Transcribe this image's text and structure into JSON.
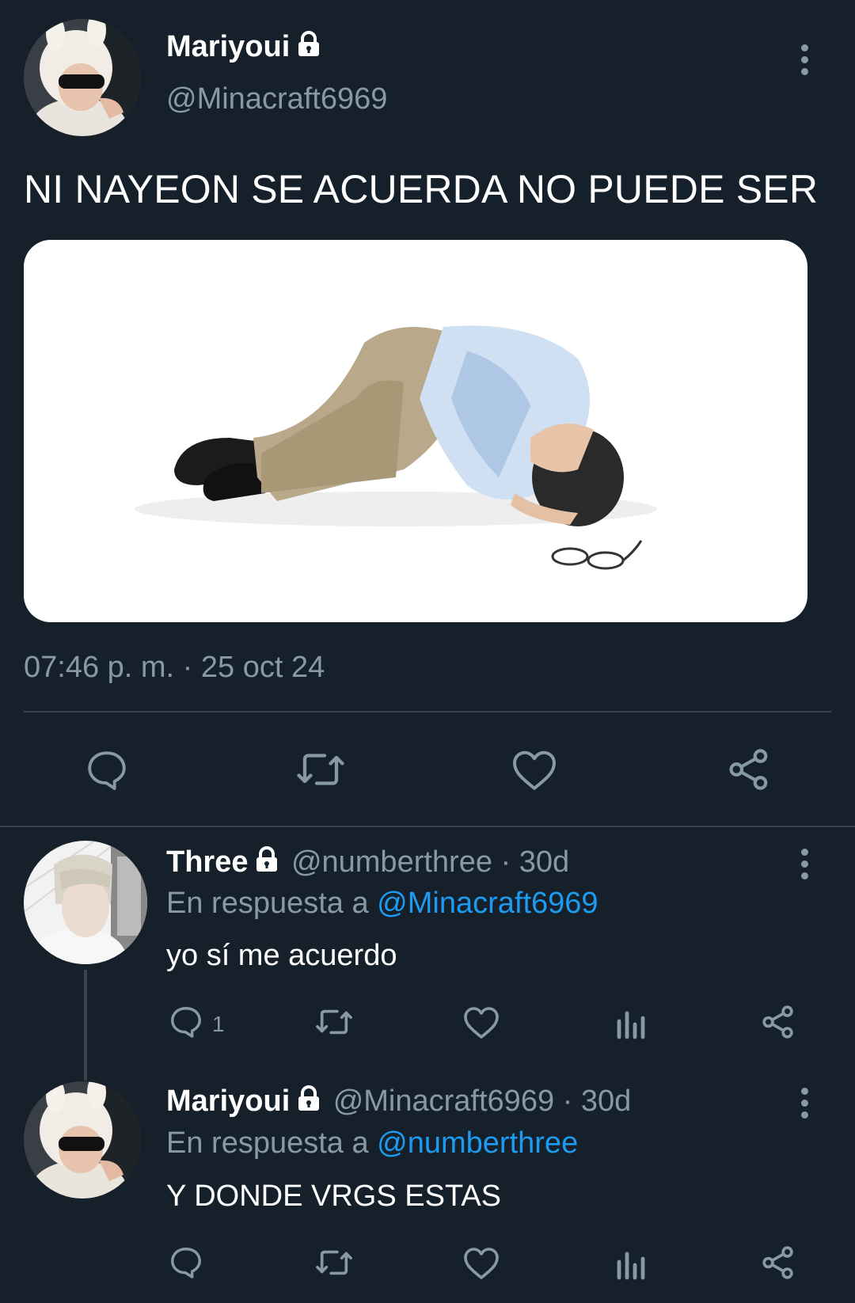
{
  "main_tweet": {
    "author_name": "Mariyoui",
    "author_handle": "@Minacraft6969",
    "text": "NI NAYEON SE ACUERDA NO PUEDE SER",
    "timestamp": "07:46 p. m. · 25 oct 24",
    "actions": [
      "reply-icon",
      "retweet-icon",
      "like-icon",
      "share-icon"
    ]
  },
  "replies": [
    {
      "author_name": "Three",
      "author_handle_time": "@numberthree · 30d",
      "reply_prefix": "En respuesta a",
      "reply_to": "@Minacraft6969",
      "text": "yo sí me acuerdo",
      "reply_count": "1",
      "actions": [
        "reply-icon",
        "retweet-icon",
        "like-icon",
        "analytics-icon",
        "share-icon"
      ]
    },
    {
      "author_name": "Mariyoui",
      "author_handle_time": "@Minacraft6969 · 30d",
      "reply_prefix": "En respuesta a",
      "reply_to": "@numberthree",
      "text": "Y DONDE VRGS ESTAS",
      "reply_count": "",
      "actions": [
        "reply-icon",
        "retweet-icon",
        "like-icon",
        "analytics-icon",
        "share-icon"
      ]
    }
  ],
  "colors": {
    "background": "#15202b",
    "secondary_text": "#8899a6",
    "link": "#1d9bf0",
    "divider": "#38444d"
  }
}
